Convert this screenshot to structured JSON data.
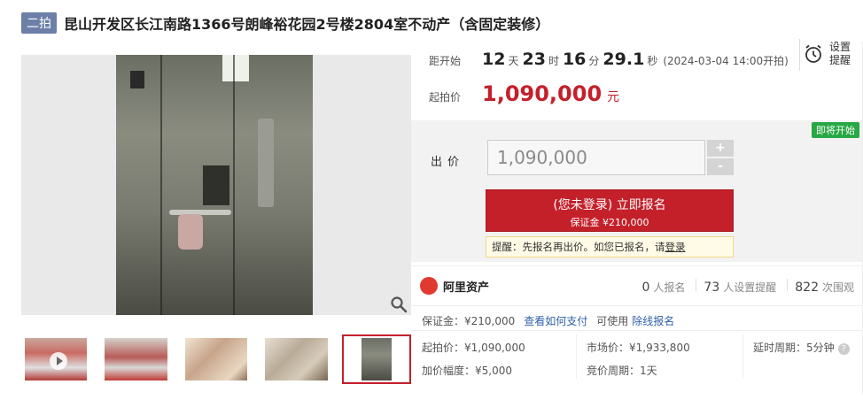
{
  "header": {
    "round_badge": "二拍",
    "title": "昆山开发区长江南路1366号朗峰裕花园2号楼2804室不动产（含固定装修）"
  },
  "countdown": {
    "label": "距开始",
    "days": "12",
    "days_unit": "天",
    "hours": "23",
    "hours_unit": "时",
    "minutes": "16",
    "minutes_unit": "分",
    "seconds": "29.1",
    "seconds_unit": "秒",
    "start_time": "(2024-03-04 14:00开拍)"
  },
  "reminder": {
    "line1": "设置",
    "line2": "提醒",
    "icon": "alarm-clock-icon"
  },
  "start_price": {
    "label": "起拍价",
    "value": "1,090,000",
    "unit": "元"
  },
  "bid": {
    "soon_badge": "即将开始",
    "label": "出价",
    "input_value": "1,090,000",
    "plus": "+",
    "minus": "-",
    "signup_line1": "(您未登录) 立即报名",
    "signup_line2": "保证金 ¥210,000",
    "tip_prefix": "提醒：先报名再出价。如您已报名，请",
    "tip_link": "登录"
  },
  "platform": {
    "logo_text": "阿里资产",
    "stats": [
      {
        "num": "0",
        "label": "人报名"
      },
      {
        "num": "73",
        "label": "人设置提醒"
      },
      {
        "num": "822",
        "label": "次围观"
      }
    ]
  },
  "details": {
    "deposit": "保证金：¥210,000",
    "how_to_pay": "查看如何支付",
    "can_use": "可使用",
    "quick_signup": "除线报名",
    "start_price": "起拍价：¥1,090,000",
    "market_price": "市场价：¥1,933,800",
    "delay": "延时周期：5分钟",
    "increment": "加价幅度：¥5,000",
    "bid_cycle": "竞价周期：1天"
  },
  "colors": {
    "accent_red": "#c4202a",
    "badge_blue": "#6b7fa8",
    "soon_green": "#27a844",
    "link_blue": "#2f5fa8"
  }
}
